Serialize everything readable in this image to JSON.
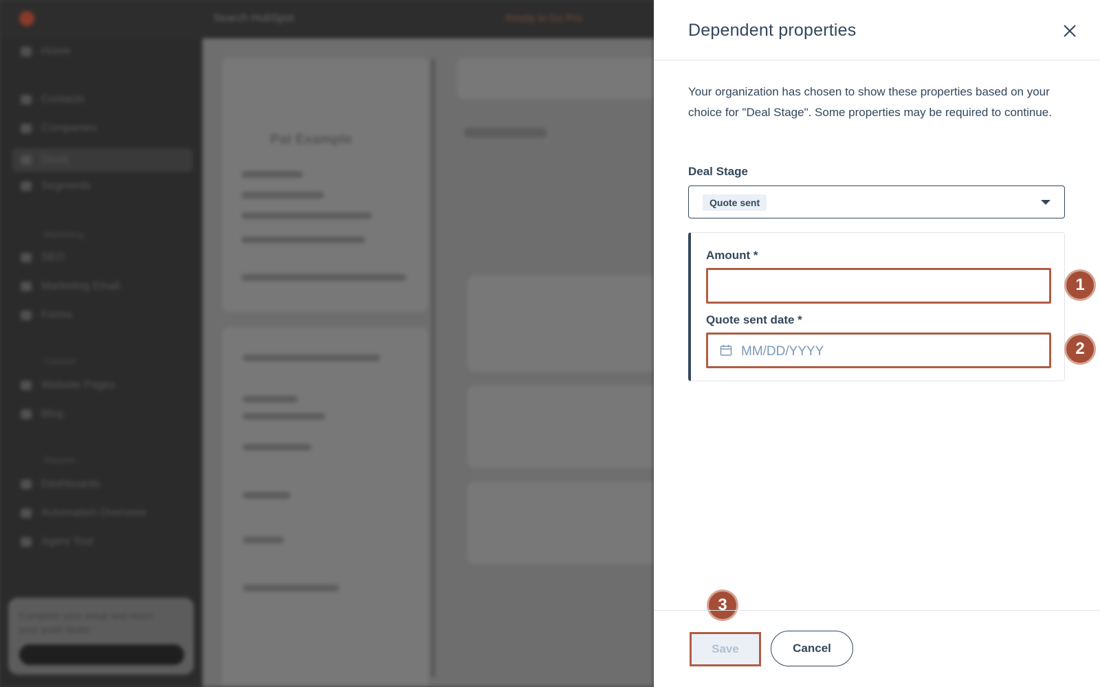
{
  "background": {
    "search_placeholder": "Search HubSpot",
    "upgrade_label": "Ready to Go Pro",
    "nav": [
      "Home",
      "Contacts",
      "Companies",
      "Deals",
      "Segments",
      "Marketing",
      "SEO",
      "Marketing Email",
      "Forms",
      "Website Pages",
      "Blog",
      "Dashboards",
      "Automation Overview",
      "Agent Tool"
    ],
    "sections": [
      "Marketing",
      "Content",
      "Reports"
    ],
    "record_title": "Pat Example",
    "promo_text": "Complete your setup and reach your goals faster"
  },
  "panel": {
    "title": "Dependent properties",
    "description": "Your organization has chosen to show these properties based on your choice for \"Deal Stage\". Some properties may be required to continue.",
    "deal_stage_label": "Deal Stage",
    "deal_stage_value": "Quote sent",
    "amount_label": "Amount *",
    "amount_value": "",
    "date_label": "Quote sent date *",
    "date_placeholder": "MM/DD/YYYY",
    "save_label": "Save",
    "cancel_label": "Cancel"
  },
  "annotations": {
    "badge_1": "1",
    "badge_2": "2",
    "badge_3": "3",
    "badge_color": "#a54e37",
    "highlight_color": "#b05c44"
  },
  "icons": {
    "close": "close-icon",
    "calendar": "calendar-icon",
    "caret": "chevron-down-icon"
  }
}
